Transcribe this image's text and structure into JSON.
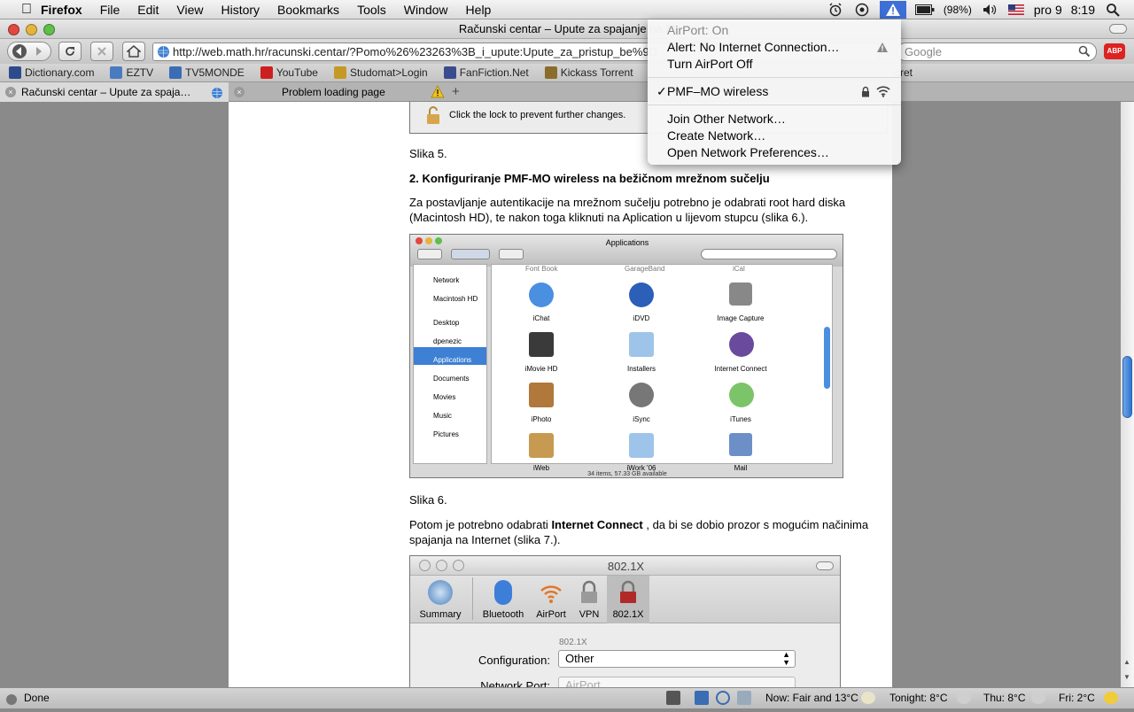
{
  "menubar": {
    "app": "Firefox",
    "items": [
      "File",
      "Edit",
      "View",
      "History",
      "Bookmarks",
      "Tools",
      "Window",
      "Help"
    ],
    "battery": "(98%)",
    "date": "pro 9",
    "time": "8:19"
  },
  "window": {
    "title": "Računski centar – Upute za spajanje na M"
  },
  "toolbar": {
    "url": "http://web.math.hr/racunski.centar/?Pomo%26%23263%3B_i_upute:Upute_za_pristup_be%9D",
    "search_placeholder": "Google"
  },
  "bookmarks": [
    {
      "label": "Dictionary.com",
      "icon": "book-icon",
      "color": "#2d4b8b"
    },
    {
      "label": "EZTV",
      "icon": "tv-icon",
      "color": "#4a7bc0"
    },
    {
      "label": "TV5MONDE",
      "icon": "tv5-icon",
      "color": "#3a6db3"
    },
    {
      "label": "YouTube",
      "icon": "youtube-icon",
      "color": "#cc1f1f"
    },
    {
      "label": "Studomat>Login",
      "icon": "grid-icon",
      "color": "#c49a24"
    },
    {
      "label": "FanFiction.Net",
      "icon": "building-icon",
      "color": "#3b4c8e"
    },
    {
      "label": "Kickass Torrent",
      "icon": "shield-icon",
      "color": "#8a6d2b"
    },
    {
      "label": "cret",
      "icon": "bookmark-icon",
      "color": "#777777"
    }
  ],
  "tabs": [
    {
      "label": "Računski centar – Upute za spaja…"
    },
    {
      "label": "Problem loading page"
    }
  ],
  "article": {
    "lock_note": "Click the lock to prevent further changes.",
    "caption5": "Slika 5.",
    "heading2": "2. Konfiguriranje PMF-MO wireless na bežičnom mrežnom sučelju",
    "para1": "Za postavljanje autentikacije na mrežnom sučelju potrebno je odabrati root hard diska (Macintosh HD), te nakon toga kliknuti na Aplication u lijevom stupcu (slika 6.).",
    "caption6": "Slika 6.",
    "para2_pre": "Potom je potrebno odabrati ",
    "para2_bold": "Internet Connect",
    "para2_post": " , da bi se dobio prozor s mogućim načinima spajanja na Internet (slika 7.)."
  },
  "finder": {
    "title": "Applications",
    "sidebar": [
      "Network",
      "Macintosh HD",
      "Desktop",
      "dpenezic",
      "Applications",
      "Documents",
      "Movies",
      "Music",
      "Pictures"
    ],
    "selected": "Applications",
    "top_row_cut": [
      "Font Book",
      "GarageBand",
      "iCal"
    ],
    "icons": [
      "iChat",
      "iDVD",
      "Image Capture",
      "iMovie HD",
      "Installers",
      "Internet Connect",
      "iPhoto",
      "iSync",
      "iTunes",
      "iWeb",
      "iWork '06",
      "Mail"
    ],
    "status": "34 items, 57.33 GB available"
  },
  "netwin": {
    "title": "802.1X",
    "toolbar": [
      "Summary",
      "Bluetooth",
      "AirPort",
      "VPN",
      "802.1X"
    ],
    "section": "802.1X",
    "config_label": "Configuration:",
    "config_value": "Other",
    "port_label": "Network Port:",
    "port_value": "AirPort"
  },
  "status": {
    "left": "Done",
    "now": "Now: Fair and 13°C",
    "tonight": "Tonight: 8°C",
    "thu": "Thu: 8°C",
    "fri": "Fri: 2°C"
  },
  "airport_menu": {
    "status": "AirPort: On",
    "alert": "Alert: No Internet Connection…",
    "turn_off": "Turn AirPort Off",
    "network": "PMF–MO wireless",
    "join": "Join Other Network…",
    "create": "Create Network…",
    "prefs": "Open Network Preferences…"
  }
}
